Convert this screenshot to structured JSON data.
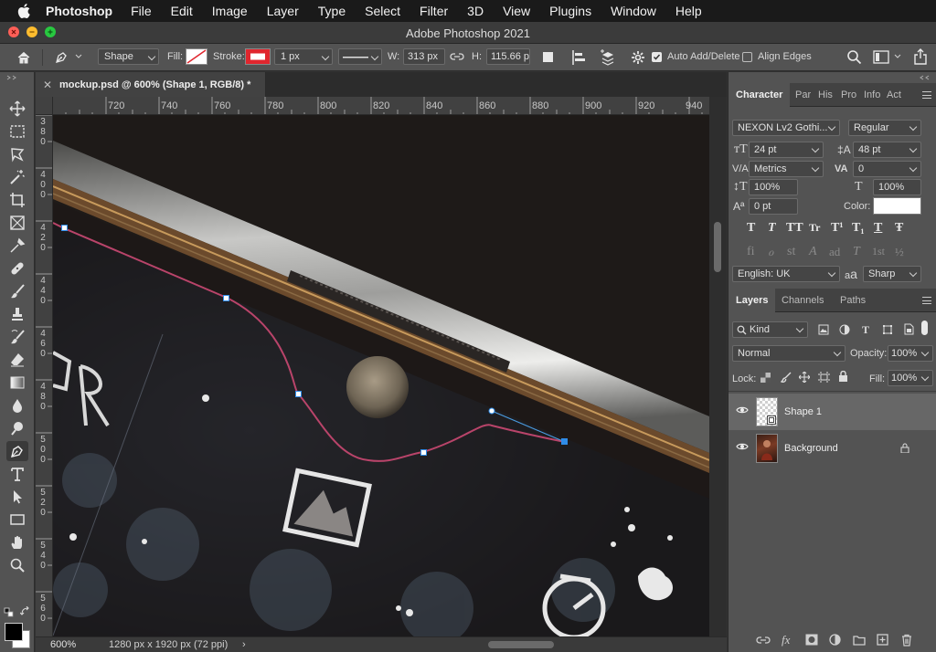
{
  "menubar": {
    "app": "Photoshop",
    "items": [
      "File",
      "Edit",
      "Image",
      "Layer",
      "Type",
      "Select",
      "Filter",
      "3D",
      "View",
      "Plugins",
      "Window",
      "Help"
    ]
  },
  "window": {
    "title": "Adobe Photoshop 2021"
  },
  "options": {
    "mode": "Shape",
    "fill_label": "Fill:",
    "stroke_label": "Stroke:",
    "stroke_width": "1 px",
    "w_label": "W:",
    "w_value": "313 px",
    "h_label": "H:",
    "h_value": "115.66 p",
    "auto_add_delete": "Auto Add/Delete",
    "auto_add_delete_checked": true,
    "align_edges": "Align Edges",
    "align_edges_checked": false,
    "stroke_color": "#e0262e"
  },
  "document": {
    "tab_title": "mockup.psd @ 600% (Shape 1, RGB/8) *",
    "zoom": "600%",
    "info": "1280 px x 1920 px (72 ppi)",
    "info_arrow": "›"
  },
  "rulers": {
    "top": [
      "720",
      "740",
      "760",
      "780",
      "800",
      "820",
      "840",
      "860",
      "880",
      "900",
      "920",
      "940"
    ],
    "left": [
      "380",
      "400",
      "420",
      "440",
      "460",
      "480",
      "500",
      "520",
      "540",
      "560"
    ]
  },
  "character": {
    "tabs": [
      "Character",
      "Par",
      "His",
      "Pro",
      "Info",
      "Act"
    ],
    "font_family": "NEXON Lv2 Gothi...",
    "font_style": "Regular",
    "size": "24 pt",
    "leading": "48 pt",
    "kerning": "Metrics",
    "tracking": "0",
    "vscale": "100%",
    "hscale": "100%",
    "baseline": "0 pt",
    "color_label": "Color:",
    "language": "English: UK",
    "aa_label": "a",
    "aa_label_big": "a",
    "antialias": "Sharp",
    "style_glyphs": [
      "T",
      "T",
      "TT",
      "Tr",
      "T¹",
      "T₁",
      "T",
      "Ŧ"
    ],
    "ot_glyphs": [
      "fi",
      "ℴ",
      "st",
      "A",
      "ad",
      "T",
      "1st",
      "½"
    ]
  },
  "layers": {
    "tabs": [
      "Layers",
      "Channels",
      "Paths"
    ],
    "filter": "Kind",
    "blend": "Normal",
    "opacity_label": "Opacity:",
    "opacity": "100%",
    "lock_label": "Lock:",
    "fill_label": "Fill:",
    "fill": "100%",
    "items": [
      {
        "name": "Shape 1",
        "selected": true
      },
      {
        "name": "Background",
        "selected": false,
        "locked": true
      }
    ]
  },
  "footer_icons": [
    "link-icon",
    "fx-icon",
    "mask-icon",
    "adjustment-icon",
    "folder-icon",
    "new-layer-icon",
    "trash-icon"
  ]
}
